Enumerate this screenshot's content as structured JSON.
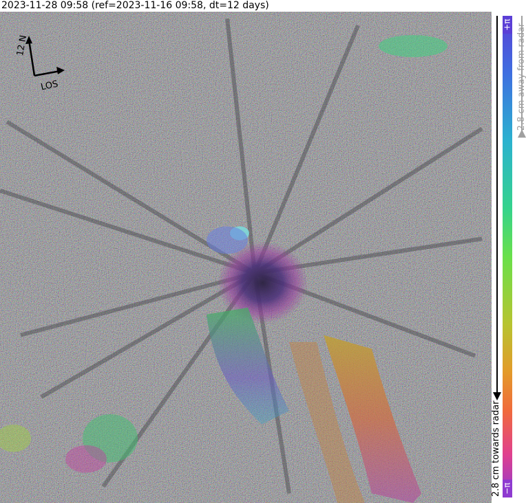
{
  "header": {
    "title": "2023-11-28 09:58 (ref=2023-11-16 09:58, dt=12 days)"
  },
  "compass": {
    "north_label": "12 N",
    "los_label": "LOS"
  },
  "colorbar": {
    "top_label": "+π",
    "bottom_label": "−π",
    "away_label": "2.8 cm away from radar",
    "towards_label": "2.8 cm towards radar",
    "away_color": "#a0a0a0",
    "towards_color": "#000000"
  },
  "image": {
    "subject": "interferogram-volcano"
  }
}
